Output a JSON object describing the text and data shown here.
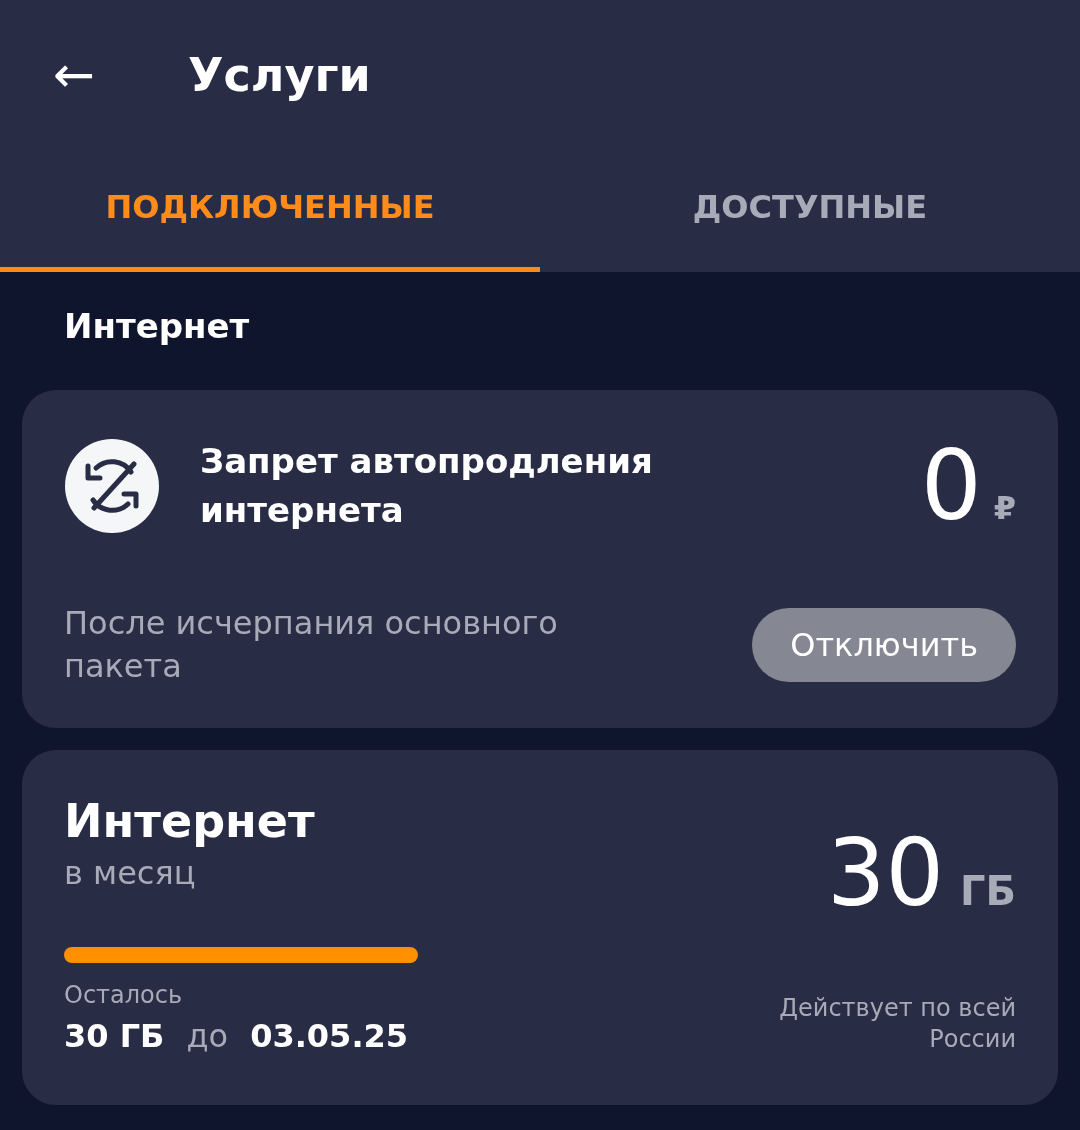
{
  "header": {
    "back_icon": "←",
    "title": "Услуги"
  },
  "tabs": [
    {
      "label": "ПОДКЛЮЧЕННЫЕ",
      "selected": true
    },
    {
      "label": "ДОСТУПНЫЕ",
      "selected": false
    }
  ],
  "section_title": "Интернет",
  "cards": [
    {
      "kind": "option",
      "title": "Запрет автопродления интернета",
      "price": "0",
      "currency": "₽",
      "description": "После исчерпания основного пакета",
      "button": "Отключить"
    },
    {
      "kind": "package",
      "title": "Интернет",
      "subtitle": "в месяц",
      "amount": "30",
      "unit": "ГБ",
      "remaining_label": "Осталось",
      "remaining": "30 ГБ",
      "until_label": "до",
      "until_date": "03.05.25",
      "coverage": "Действует по всей России"
    }
  ]
}
